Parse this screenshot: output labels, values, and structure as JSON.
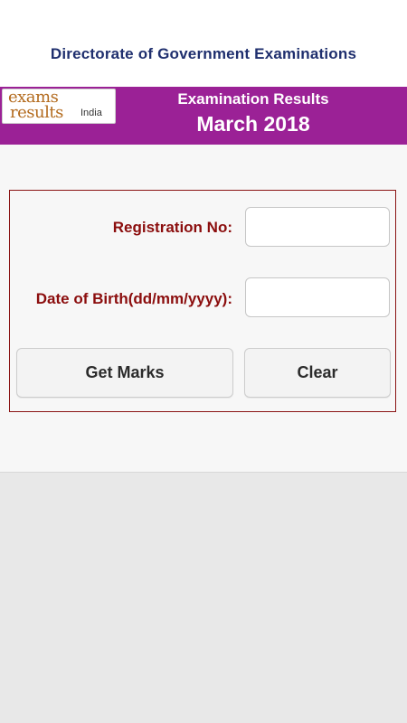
{
  "header": {
    "org_title": "Directorate of Government Examinations"
  },
  "banner": {
    "logo": {
      "line1": "exams",
      "line2": "results",
      "suffix": "India"
    },
    "title": "Examination Results",
    "subtitle": "March 2018",
    "background": "#9b2196"
  },
  "form": {
    "registration_label": "Registration No:",
    "registration_value": "",
    "dob_label": "Date of Birth(dd/mm/yyyy):",
    "dob_value": "",
    "get_marks_label": "Get Marks",
    "clear_label": "Clear",
    "label_color": "#8b0d0d",
    "border_color": "#8b1414"
  }
}
